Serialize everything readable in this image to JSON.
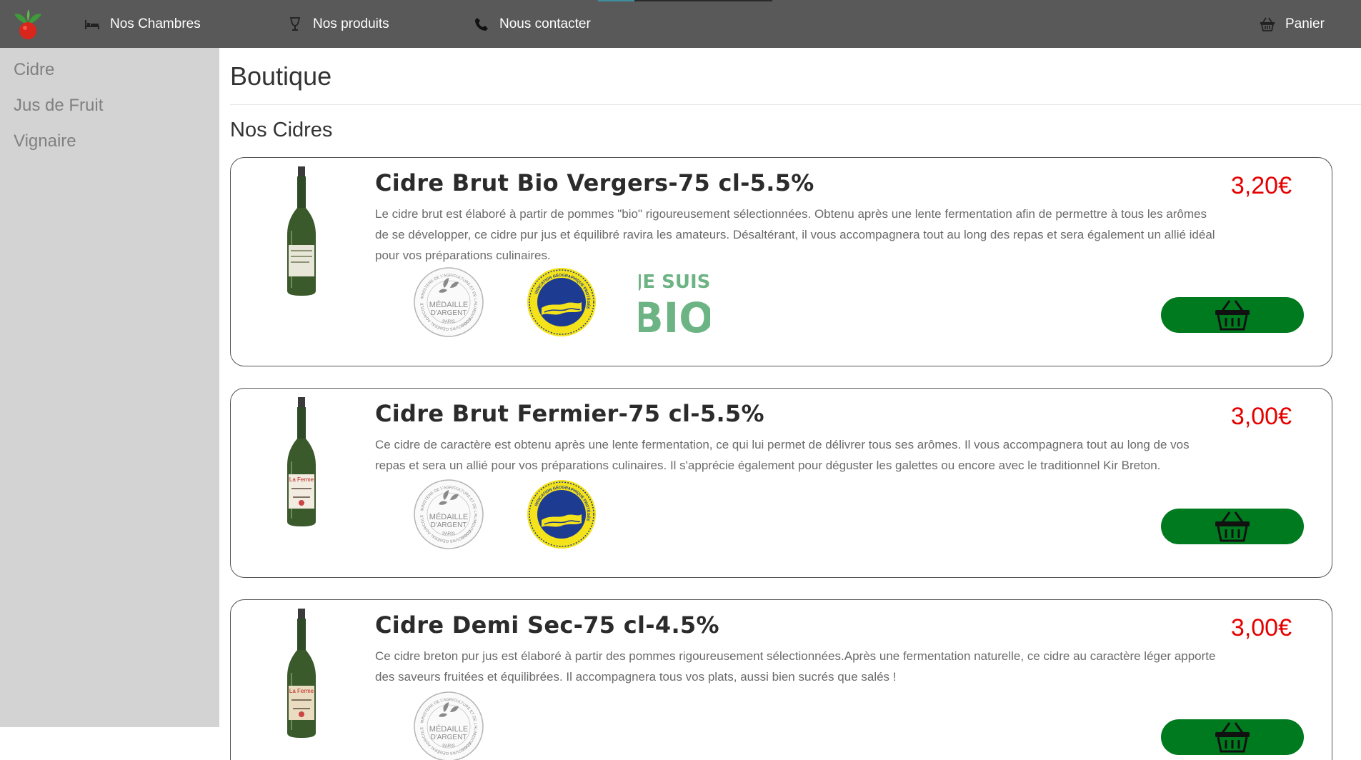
{
  "nav": {
    "items": [
      {
        "label": "Nos Chambres",
        "icon": "bed-icon"
      },
      {
        "label": "Nos produits",
        "icon": "goblet-icon"
      },
      {
        "label": "Nous contacter",
        "icon": "phone-icon"
      }
    ],
    "cart": {
      "label": "Panier",
      "icon": "basket-icon"
    },
    "logo": "apple-leaves-logo",
    "colors": {
      "bar": "#595959",
      "accent": "#3d8fa0"
    }
  },
  "sidebar": {
    "items": [
      {
        "label": "Cidre"
      },
      {
        "label": "Jus de Fruit"
      },
      {
        "label": "Vignaire"
      }
    ]
  },
  "main": {
    "title": "Boutique",
    "section": "Nos Cidres"
  },
  "products": [
    {
      "name": "Cidre Brut Bio Vergers-75 cl-5.5%",
      "price": "3,20€",
      "description": "Le cidre brut est élaboré à partir de pommes \"bio\" rigoureusement sélectionnées. Obtenu après une lente fermentation afin de permettre à tous les arômes de se développer, ce cidre pur jus et équilibré ravira les amateurs. Désaltérant, il vous accompagnera tout au long des repas et sera également un allié idéal pour vos préparations culinaires.",
      "badges": [
        "medaille-argent",
        "igp",
        "bio"
      ]
    },
    {
      "name": "Cidre Brut Fermier-75 cl-5.5%",
      "price": "3,00€",
      "description": "Ce cidre de caractère est obtenu après une lente fermentation, ce qui lui permet de délivrer tous ses arômes. Il vous accompagnera tout au long de vos repas et sera un allié pour vos préparations culinaires. Il s'apprécie également pour déguster les galettes ou encore avec le traditionnel Kir Breton.",
      "badges": [
        "medaille-argent",
        "igp"
      ]
    },
    {
      "name": "Cidre Demi Sec-75 cl-4.5%",
      "price": "3,00€",
      "description": "Ce cidre breton pur jus est élaboré à partir des pommes rigoureusement sélectionnées.Après une fermentation naturelle, ce cidre au caractère léger apporte des saveurs fruitées et équilibrées. Il accompagnera tous vos plats, aussi bien sucrés que salés !",
      "badges": [
        "medaille-argent"
      ]
    }
  ],
  "badge_text": {
    "medal_line1": "MÉDAILLE",
    "medal_line2": "D'ARGENT",
    "medal_line3": "PARIS",
    "medal_ring_top": "MINISTÈRE DE L'AGRICULTURE ET DE L'ALIMENTATION",
    "medal_ring_bottom": "CONCOURS GÉNÉRAL AGRICOLE",
    "igp_ring": "INDICATION GÉOGRAPHIQUE PROTÉGÉE",
    "bio_line1": "JE SUIS",
    "bio_line2": "BIO"
  },
  "colors": {
    "price": "#e60000",
    "cart_button": "#007a1e",
    "sidebar": "#d3d3d3"
  }
}
